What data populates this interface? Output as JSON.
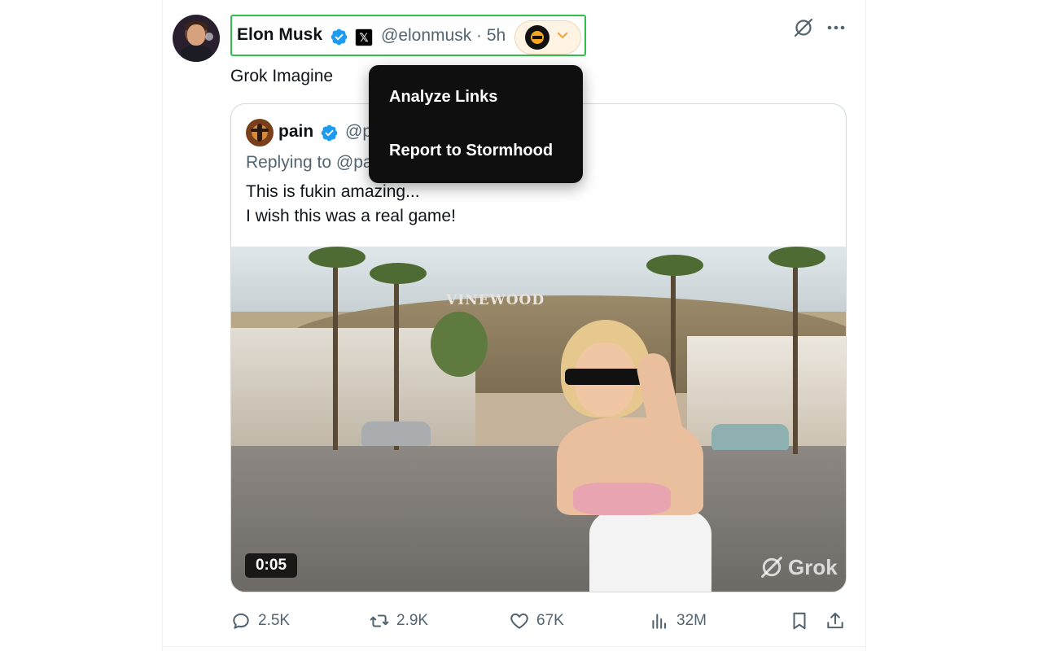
{
  "post": {
    "author_name": "Elon Musk",
    "x_badge": "𝕏",
    "handle_time": "@elonmusk · 5h",
    "text": "Grok Imagine",
    "icons": {
      "verified": "verified-badge-icon",
      "grok": "grok-icon",
      "more": "more-options-icon",
      "extension": "stormhood-extension-icon",
      "chevron": "chevron-down-icon"
    },
    "accent_color": "#1d9bf0",
    "highlight_color": "#2fbf4a"
  },
  "menu": {
    "items": [
      {
        "label": "Analyze Links"
      },
      {
        "label": "Report to Stormhood"
      }
    ]
  },
  "quote": {
    "author_name": "pain",
    "handle": "@p",
    "reply_to": "Replying to @pa",
    "lines": [
      "This is fukin amazing...",
      "I wish this was a real game!"
    ],
    "media": {
      "sign_text": "VINEWOOD",
      "duration": "0:05",
      "watermark": "Grok"
    }
  },
  "actions": {
    "replies": "2.5K",
    "reposts": "2.9K",
    "likes": "67K",
    "views": "32M"
  }
}
